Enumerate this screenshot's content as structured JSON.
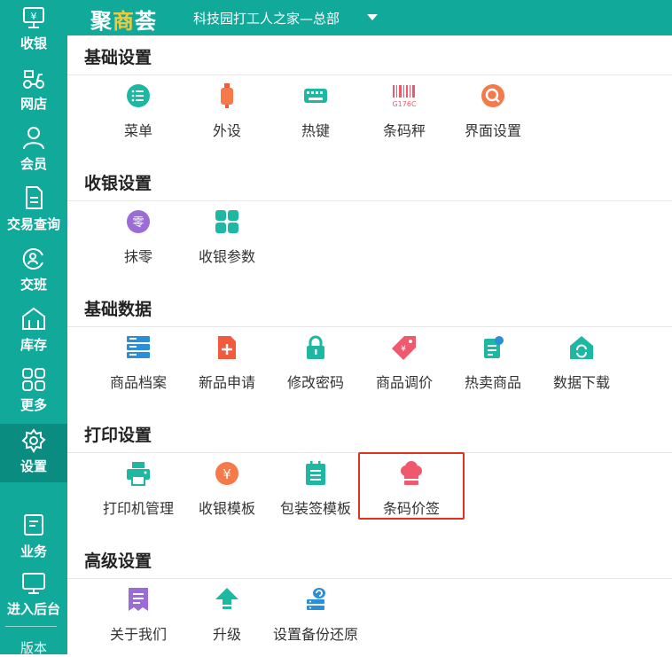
{
  "app": {
    "logo_a": "聚",
    "logo_b": "商",
    "logo_c": "荟",
    "store": "科技园打工人之家—总部"
  },
  "sidebar": {
    "items": [
      {
        "label": "收银"
      },
      {
        "label": "网店"
      },
      {
        "label": "会员"
      },
      {
        "label": "交易查询"
      },
      {
        "label": "交班"
      },
      {
        "label": "库存"
      },
      {
        "label": "更多"
      },
      {
        "label": "设置"
      },
      {
        "label": "业务"
      },
      {
        "label": "进入后台"
      },
      {
        "label": "版本"
      }
    ],
    "active": "设置"
  },
  "sections": [
    {
      "title": "基础设置",
      "items": [
        {
          "label": "菜单",
          "icon": "menu-icon"
        },
        {
          "label": "外设",
          "icon": "peripheral-icon"
        },
        {
          "label": "热键",
          "icon": "keyboard-icon"
        },
        {
          "label": "条码秤",
          "icon": "barcode-scale-icon",
          "badge": "G176C"
        },
        {
          "label": "界面设置",
          "icon": "interface-icon"
        }
      ]
    },
    {
      "title": "收银设置",
      "items": [
        {
          "label": "抹零",
          "icon": "round-off-icon",
          "badge": "零"
        },
        {
          "label": "收银参数",
          "icon": "grid-icon"
        }
      ]
    },
    {
      "title": "基础数据",
      "items": [
        {
          "label": "商品档案",
          "icon": "server-icon"
        },
        {
          "label": "新品申请",
          "icon": "new-item-icon"
        },
        {
          "label": "修改密码",
          "icon": "lock-icon"
        },
        {
          "label": "商品调价",
          "icon": "price-tag-icon"
        },
        {
          "label": "热卖商品",
          "icon": "hot-sale-icon"
        },
        {
          "label": "数据下载",
          "icon": "download-icon"
        }
      ]
    },
    {
      "title": "打印设置",
      "items": [
        {
          "label": "打印机管理",
          "icon": "printer-icon"
        },
        {
          "label": "收银模板",
          "icon": "yen-icon",
          "badge": "¥"
        },
        {
          "label": "包装签模板",
          "icon": "package-label-icon"
        },
        {
          "label": "条码价签",
          "icon": "chef-hat-icon"
        }
      ]
    },
    {
      "title": "高级设置",
      "items": [
        {
          "label": "关于我们",
          "icon": "about-icon"
        },
        {
          "label": "升级",
          "icon": "upgrade-icon"
        },
        {
          "label": "设置备份还原",
          "icon": "backup-icon"
        }
      ]
    }
  ],
  "colors": {
    "teal": "#10a99a",
    "active": "#0b8c80",
    "highlight": "#e0301e",
    "logo_accent": "#f3c93b"
  }
}
